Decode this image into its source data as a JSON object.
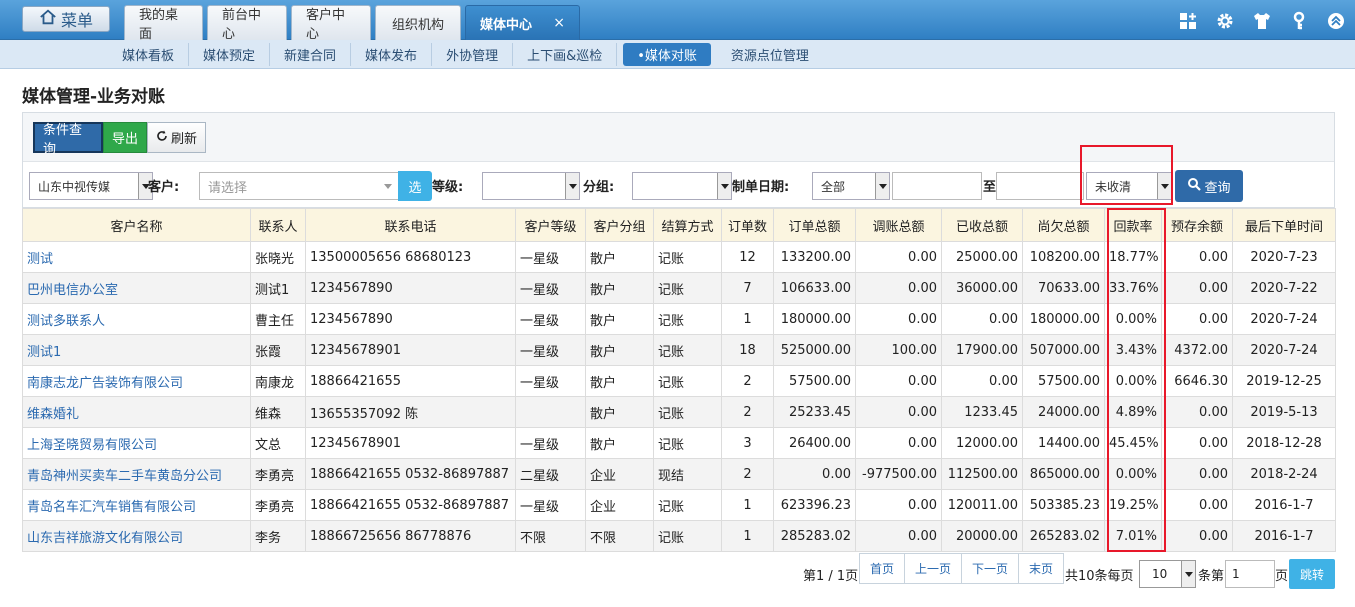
{
  "header": {
    "menu_label": "菜单",
    "tabs": [
      {
        "label": "我的桌面"
      },
      {
        "label": "前台中心"
      },
      {
        "label": "客户中心"
      },
      {
        "label": "组织机构"
      },
      {
        "label": "媒体中心",
        "close": "×"
      }
    ],
    "icons": [
      "grid-plus-icon",
      "gear-icon",
      "shirt-icon",
      "key-icon",
      "collapse-up-icon"
    ]
  },
  "subnav": {
    "items": [
      "媒体看板",
      "媒体预定",
      "新建合同",
      "媒体发布",
      "外协管理",
      "上下画&巡检",
      "•媒体对账",
      "资源点位管理"
    ]
  },
  "page_title": "媒体管理-业务对账",
  "toolbar": {
    "filter_label": "条件查询",
    "export_label": "导出",
    "refresh_label": "刷新"
  },
  "filters": {
    "company": "山东中视传媒",
    "customer_label": "客户:",
    "customer_placeholder": "请选择",
    "pick_label": "选",
    "level_label": "等级:",
    "level_value": "",
    "group_label": "分组:",
    "group_value": "",
    "date_label": "制单日期:",
    "date_scope": "全部",
    "date_from": "",
    "to_label": "至",
    "date_to": "",
    "status": "未收清",
    "query_label": "查询"
  },
  "table": {
    "headers": [
      "客户名称",
      "联系人",
      "联系电话",
      "客户等级",
      "客户分组",
      "结算方式",
      "订单数",
      "订单总额",
      "调账总额",
      "已收总额",
      "尚欠总额",
      "回款率",
      "预存余额",
      "最后下单时间"
    ],
    "rows": [
      [
        "测试",
        "张晓光",
        "13500005656 68680123",
        "一星级",
        "散户",
        "记账",
        "12",
        "133200.00",
        "0.00",
        "25000.00",
        "108200.00",
        "18.77%",
        "0.00",
        "2020-7-23"
      ],
      [
        "巴州电信办公室",
        "测试1",
        "1234567890",
        "一星级",
        "散户",
        "记账",
        "7",
        "106633.00",
        "0.00",
        "36000.00",
        "70633.00",
        "33.76%",
        "0.00",
        "2020-7-22"
      ],
      [
        "测试多联系人",
        "曹主任",
        "1234567890",
        "一星级",
        "散户",
        "记账",
        "1",
        "180000.00",
        "0.00",
        "0.00",
        "180000.00",
        "0.00%",
        "0.00",
        "2020-7-24"
      ],
      [
        "测试1",
        "张霞",
        "12345678901",
        "一星级",
        "散户",
        "记账",
        "18",
        "525000.00",
        "100.00",
        "17900.00",
        "507000.00",
        "3.43%",
        "4372.00",
        "2020-7-24"
      ],
      [
        "南康志龙广告装饰有限公司",
        "南康龙",
        "18866421655",
        "一星级",
        "散户",
        "记账",
        "2",
        "57500.00",
        "0.00",
        "0.00",
        "57500.00",
        "0.00%",
        "6646.30",
        "2019-12-25"
      ],
      [
        "维森婚礼",
        "维森",
        "13655357092 陈",
        "",
        "散户",
        "记账",
        "2",
        "25233.45",
        "0.00",
        "1233.45",
        "24000.00",
        "4.89%",
        "0.00",
        "2019-5-13"
      ],
      [
        "上海圣晓贸易有限公司",
        "文总",
        "12345678901",
        "一星级",
        "散户",
        "记账",
        "3",
        "26400.00",
        "0.00",
        "12000.00",
        "14400.00",
        "45.45%",
        "0.00",
        "2018-12-28"
      ],
      [
        "青岛神州买卖车二手车黄岛分公司",
        "李勇亮",
        "18866421655 0532-86897887",
        "二星级",
        "企业",
        "现结",
        "2",
        "0.00",
        "-977500.00",
        "112500.00",
        "865000.00",
        "0.00%",
        "0.00",
        "2018-2-24"
      ],
      [
        "青岛名车汇汽车销售有限公司",
        "李勇亮",
        "18866421655 0532-86897887",
        "一星级",
        "企业",
        "记账",
        "1",
        "623396.23",
        "0.00",
        "120011.00",
        "503385.23",
        "19.25%",
        "0.00",
        "2016-1-7"
      ],
      [
        "山东吉祥旅游文化有限公司",
        "李务",
        "18866725656 86778876",
        "不限",
        "不限",
        "记账",
        "1",
        "285283.02",
        "0.00",
        "20000.00",
        "265283.02",
        "7.01%",
        "0.00",
        "2016-1-7"
      ]
    ]
  },
  "pager": {
    "page_info": "第1 / 1页",
    "first": "首页",
    "prev": "上一页",
    "next": "下一页",
    "last": "末页",
    "total_text": "共10条每页",
    "per_page": "10",
    "goto_prefix": "条第",
    "goto_value": "1",
    "goto_suffix": "页",
    "jump": "跳转"
  },
  "colors": {
    "header_blue": "#2f7fc3",
    "highlight_red": "#e8182a",
    "link_blue": "#2b6ab0",
    "table_header_bg": "#fbf5e0"
  }
}
